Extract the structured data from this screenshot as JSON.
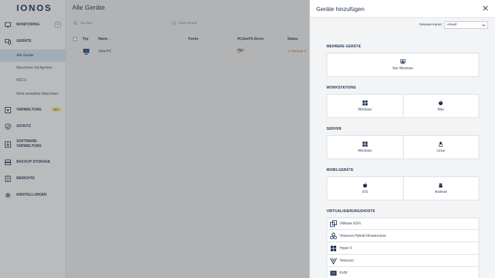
{
  "brand": "IONOS",
  "sidebar": {
    "collapse": "«",
    "items": [
      {
        "label": "Monitoring",
        "icon": "monitor-icon"
      },
      {
        "label": "Geräte",
        "icon": "devices-icon"
      },
      {
        "label": "Verwaltung",
        "icon": "management-icon",
        "badge": "NEU"
      },
      {
        "label": "Schutz",
        "icon": "shield-icon"
      },
      {
        "label": "Software-Verwaltung",
        "icon": "software-icon"
      },
      {
        "label": "Backup Storage",
        "icon": "storage-icon"
      },
      {
        "label": "Berichte",
        "icon": "reports-icon"
      },
      {
        "label": "Einstellungen",
        "icon": "gear-icon"
      }
    ],
    "sub_items": [
      "Alle Geräte",
      "Maschinen mit Agenten",
      "NGCS",
      "Nicht verwaltete Maschinen"
    ]
  },
  "main": {
    "title": "Alle Geräte",
    "search_placeholder": "Suchen",
    "quick_assist": "Quick Assist",
    "columns": [
      "Typ",
      "Name ↑",
      "Konto",
      "#CyberFit-Score",
      "Status"
    ],
    "rows": [
      {
        "name": "Julia-PC",
        "konto": "",
        "score": "750",
        "score_max": " / 850",
        "status": "Backup n"
      }
    ]
  },
  "panel": {
    "title": "Geräte hinzufügen",
    "release_label": "Release-Kanal:",
    "release_value": "Aktuell",
    "sections": {
      "multi": {
        "label": "MEHRERE GERÄTE",
        "cards": [
          "Nur Windows"
        ]
      },
      "workstations": {
        "label": "WORKSTATIONS",
        "cards": [
          "Windows",
          "Mac"
        ]
      },
      "server": {
        "label": "SERVER",
        "cards": [
          "Windows",
          "Linux"
        ]
      },
      "mobile": {
        "label": "MOBILGERÄTE",
        "cards": [
          "iOS",
          "Android"
        ]
      },
      "virt": {
        "label": "VIRTUALISIERUNGSHOSTS",
        "items": [
          "VMware ESXi",
          "Virtuozzo Hybrid Infrastructure",
          "Hyper-V",
          "Virtuozzo",
          "KVM"
        ]
      }
    }
  },
  "colors": {
    "accent": "#0b2a63",
    "active": "#c9e0f2",
    "panel_bg": "#f3f4f6"
  }
}
